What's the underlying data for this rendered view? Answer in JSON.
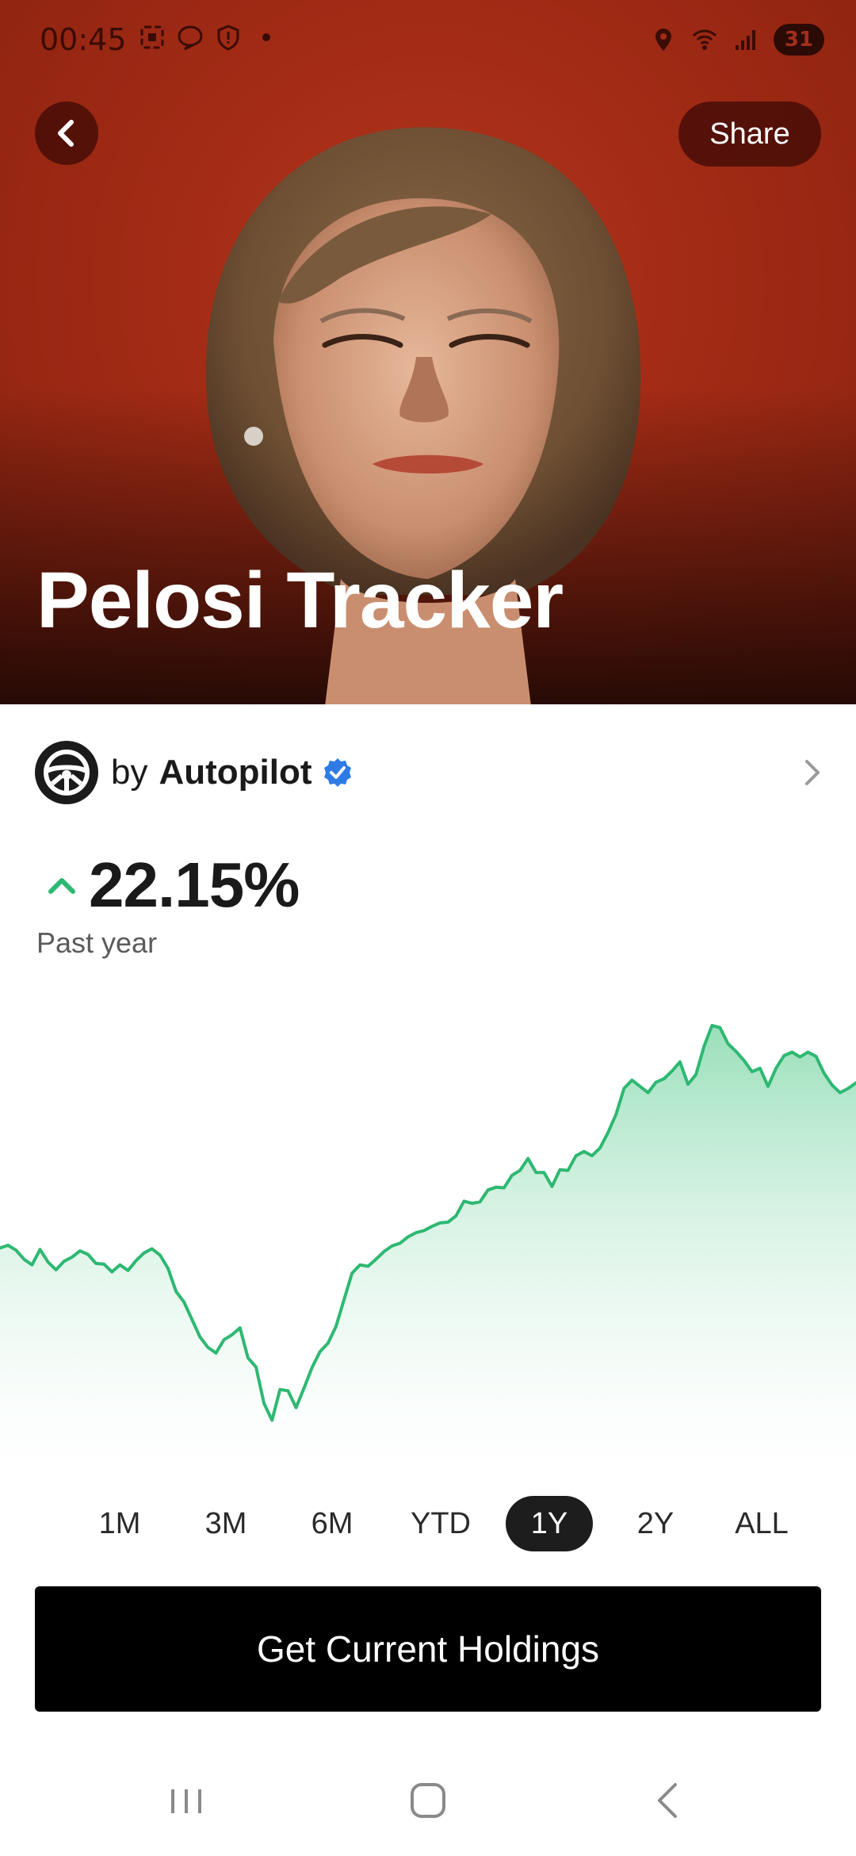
{
  "status_bar": {
    "time": "00:45",
    "battery": "31",
    "icons": [
      "screenshot-icon",
      "chat-bubble-icon",
      "shield-icon",
      "dot-icon",
      "location-icon",
      "wifi-icon",
      "signal-icon",
      "battery-icon"
    ]
  },
  "hero": {
    "title": "Pelosi Tracker",
    "share_label": "Share",
    "back_icon": "chevron-left-icon",
    "background_color": "#a22b15"
  },
  "author": {
    "by_label": "by",
    "name": "Autopilot",
    "verified_icon": "verified-badge-icon",
    "avatar_icon": "steering-wheel-icon",
    "verified_color": "#2f7be5"
  },
  "performance": {
    "value": "22.15%",
    "period": "Past year",
    "direction_icon": "caret-up-icon",
    "accent_color": "#2eb872"
  },
  "chart_data": {
    "type": "area",
    "title": "",
    "xlabel": "",
    "ylabel": "",
    "grid": false,
    "line_color": "#2eb872",
    "fill_color": "#bfe9d2",
    "series": [
      {
        "values": [
          50.2,
          50.6,
          49.9,
          48.6,
          47.8,
          50.0,
          48.2,
          47.1,
          48.3,
          48.9,
          49.8,
          49.3,
          48.0,
          47.9,
          46.8,
          47.8,
          47.0,
          48.4,
          49.5,
          50.1,
          49.2,
          47.3,
          44.0,
          42.5,
          40.0,
          37.5,
          36.0,
          35.2,
          37.1,
          37.8,
          38.8,
          34.5,
          33.2,
          28.0,
          25.6,
          30.0,
          29.8,
          27.4,
          30.2,
          33.1,
          35.4,
          36.6,
          39.0,
          42.8,
          46.6,
          47.8,
          47.6,
          48.6,
          49.7,
          50.5,
          50.9,
          51.8,
          52.4,
          52.7,
          53.3,
          53.8,
          53.9,
          54.8,
          56.9,
          56.6,
          56.8,
          58.5,
          58.9,
          58.8,
          60.6,
          61.3,
          63.0,
          61.0,
          61.0,
          59.0,
          61.4,
          61.3,
          63.4,
          64.0,
          63.4,
          64.5,
          66.7,
          69.3,
          73.0,
          74.2,
          73.3,
          72.4,
          73.9,
          74.4,
          75.5,
          76.8,
          73.6,
          75.0,
          79.0,
          82.0,
          81.7,
          79.4,
          78.3,
          77.0,
          75.4,
          75.9,
          73.3,
          75.9,
          77.7,
          78.2,
          77.5,
          78.2,
          77.6,
          75.2,
          73.5,
          72.4,
          73.0,
          73.8
        ]
      }
    ],
    "ylim": [
      20,
      88
    ]
  },
  "range_tabs": {
    "items": [
      "1M",
      "3M",
      "6M",
      "YTD",
      "1Y",
      "2Y",
      "ALL"
    ],
    "selected": "1Y"
  },
  "cta": {
    "label": "Get Current Holdings"
  },
  "nav_bar": {
    "icons": [
      "recent-apps-icon",
      "home-icon",
      "back-icon"
    ]
  }
}
